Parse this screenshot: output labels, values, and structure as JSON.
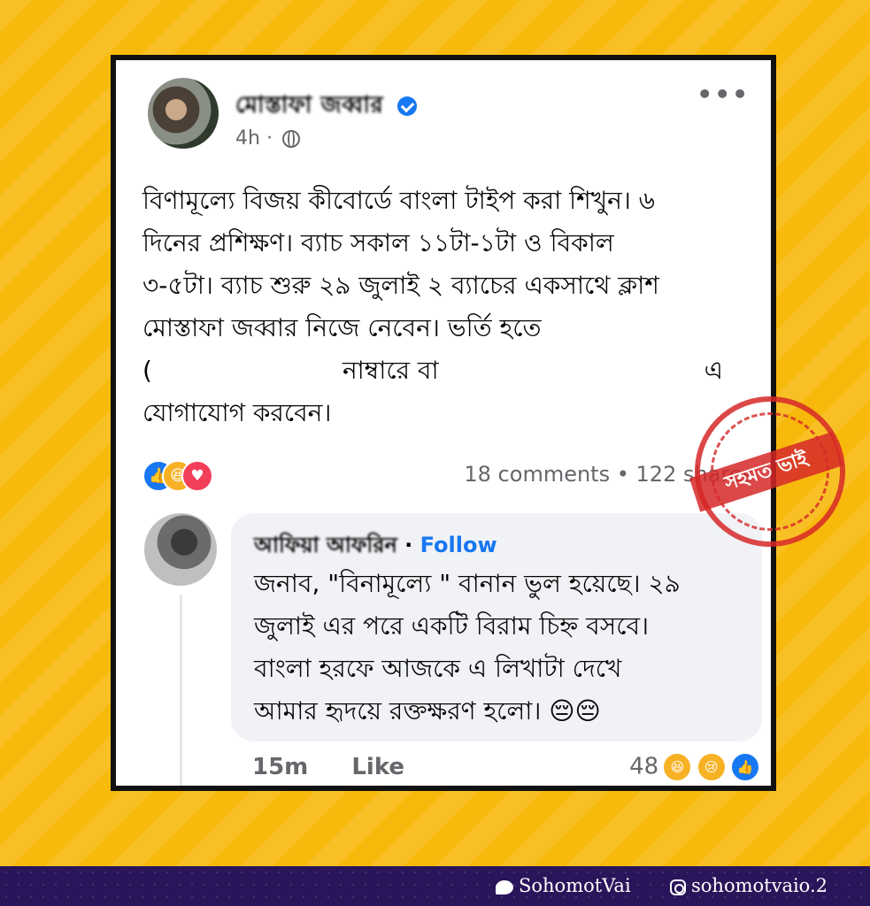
{
  "post": {
    "author_name": "মোস্তাফা জব্বার",
    "time": "4h",
    "separator": "·",
    "text_lines": [
      "বিণামূল্যে বিজয় কীবোর্ডে বাংলা টাইপ করা শিখুন। ৬",
      "দিনের প্রশিক্ষণ। ব্যাচ সকাল ১১টা-১টা ও বিকাল",
      "৩-৫টা। ব্যাচ শুরু ২৯ জুলাই ২ ব্যাচের একসাথে ক্লাশ",
      "মোস্তাফা জব্বার নিজে নেবেন। ভর্তি হতে"
    ],
    "line5_part1": "(",
    "line5_part2": "নাম্বারে বা",
    "line5_part3": "এ",
    "line6": "যোগাযোগ করবেন।",
    "comments_count": "18 comments",
    "dot": "•",
    "shares": "122 shares",
    "more_menu": "•••"
  },
  "comment": {
    "author_name": "আফিয়া আফরিন",
    "follow_sep": "·",
    "follow_label": "Follow",
    "text_lines": [
      "জনাব, \"বিনামূল্যে \" বানান ভুল হয়েছে। ২৯",
      "জুলাই এর পরে একটি বিরাম চিহ্ন বসবে।",
      "বাংলা হরফে আজকে এ লিখাটা দেখে",
      "আমার হৃদয়ে রক্তক্ষরণ হলো।  😔😔"
    ],
    "time": "15m",
    "like_label": "Like",
    "reaction_count": "48"
  },
  "watermark": {
    "text": "সহমত ভাই"
  },
  "footer": {
    "twitter": "SohomotVai",
    "instagram": "sohomotvaio.2"
  },
  "colors": {
    "background": "#f7b90b",
    "link_blue": "#1877f2",
    "bottom_bar": "#2a145a"
  }
}
